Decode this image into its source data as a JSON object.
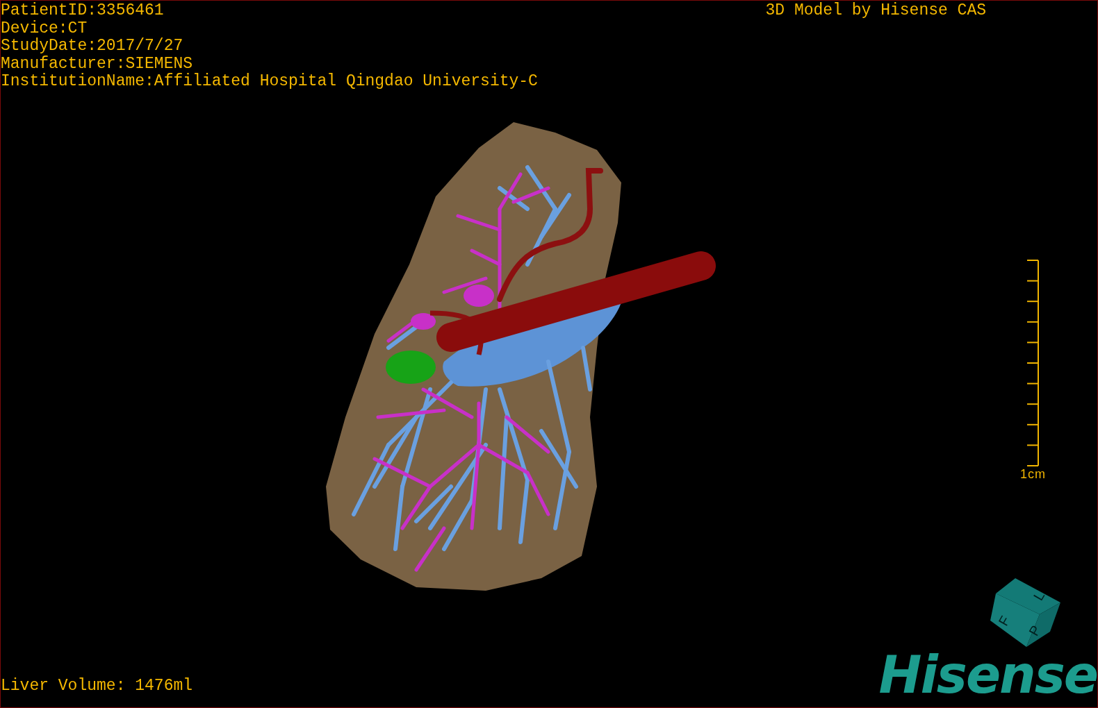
{
  "info_lines": [
    "PatientID:3356461",
    "Device:CT",
    "StudyDate:2017/7/27",
    "Manufacturer:SIEMENS",
    "InstitutionName:Affiliated Hospital Qingdao University-C"
  ],
  "title": "3D Model by Hisense CAS",
  "scale_bar": {
    "label": "1cm"
  },
  "orientation_cube": {
    "faces": [
      "F",
      "L",
      "P"
    ]
  },
  "logo": "Hisense",
  "volume": "Liver Volume: 1476ml"
}
